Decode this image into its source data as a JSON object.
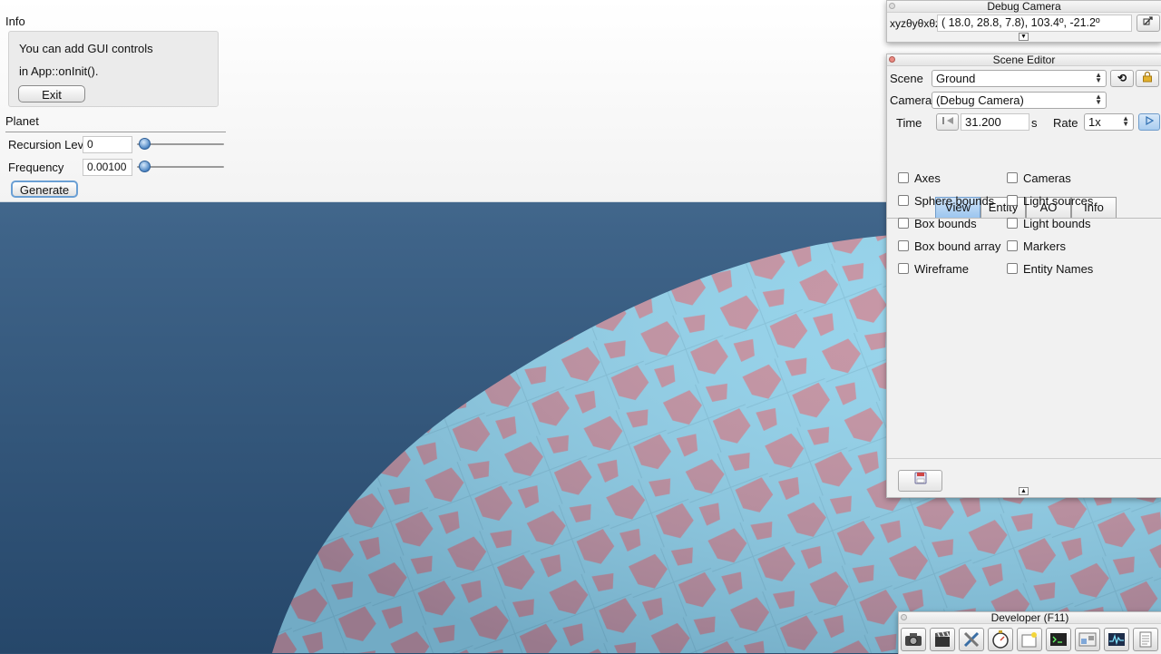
{
  "gui": {
    "info_title": "Info",
    "info_line1": "You can add GUI controls",
    "info_line2": "in App::onInit().",
    "exit_label": "Exit",
    "planet_title": "Planet",
    "recursion_label": "Recursion Level",
    "recursion_value": "0",
    "recursion_level": 0,
    "frequency_label": "Frequency",
    "frequency_value": "0.00100",
    "generate_label": "Generate"
  },
  "debug_camera": {
    "title": "Debug Camera",
    "axis_label": "xyzθyθxθz",
    "coordinates": "( 18.0,  28.8,   7.8),  103.4º, -21.2º"
  },
  "scene_editor": {
    "title": "Scene Editor",
    "scene_label": "Scene",
    "scene_value": "Ground",
    "camera_label": "Camera",
    "camera_value": "(Debug Camera)",
    "time_label": "Time",
    "time_value": "31.200",
    "time_unit": "s",
    "rate_label": "Rate",
    "rate_value": "1x",
    "tabs": [
      {
        "label": "View",
        "active": true
      },
      {
        "label": "Entity",
        "active": false
      },
      {
        "label": "AO",
        "active": false
      },
      {
        "label": "Info",
        "active": false
      }
    ],
    "checkboxes_left": [
      "Axes",
      "Sphere bounds",
      "Box bounds",
      "Box bound array",
      "Wireframe"
    ],
    "checkboxes_right": [
      "Cameras",
      "Light sources",
      "Light bounds",
      "Markers",
      "Entity Names"
    ]
  },
  "developer": {
    "title": "Developer (F11)",
    "tools": [
      "camera-icon",
      "film-clapper-icon",
      "tools-icon",
      "stopwatch-icon",
      "new-window-icon",
      "console-icon",
      "scene-graph-icon",
      "profiler-icon",
      "log-icon"
    ]
  },
  "colors": {
    "sky_top": "#5a7fa2",
    "sky_bottom": "#2d4f70",
    "planet_blue": "#8fd1ea",
    "planet_pink": "#c38e9e",
    "accent": "#6a9fd4"
  }
}
